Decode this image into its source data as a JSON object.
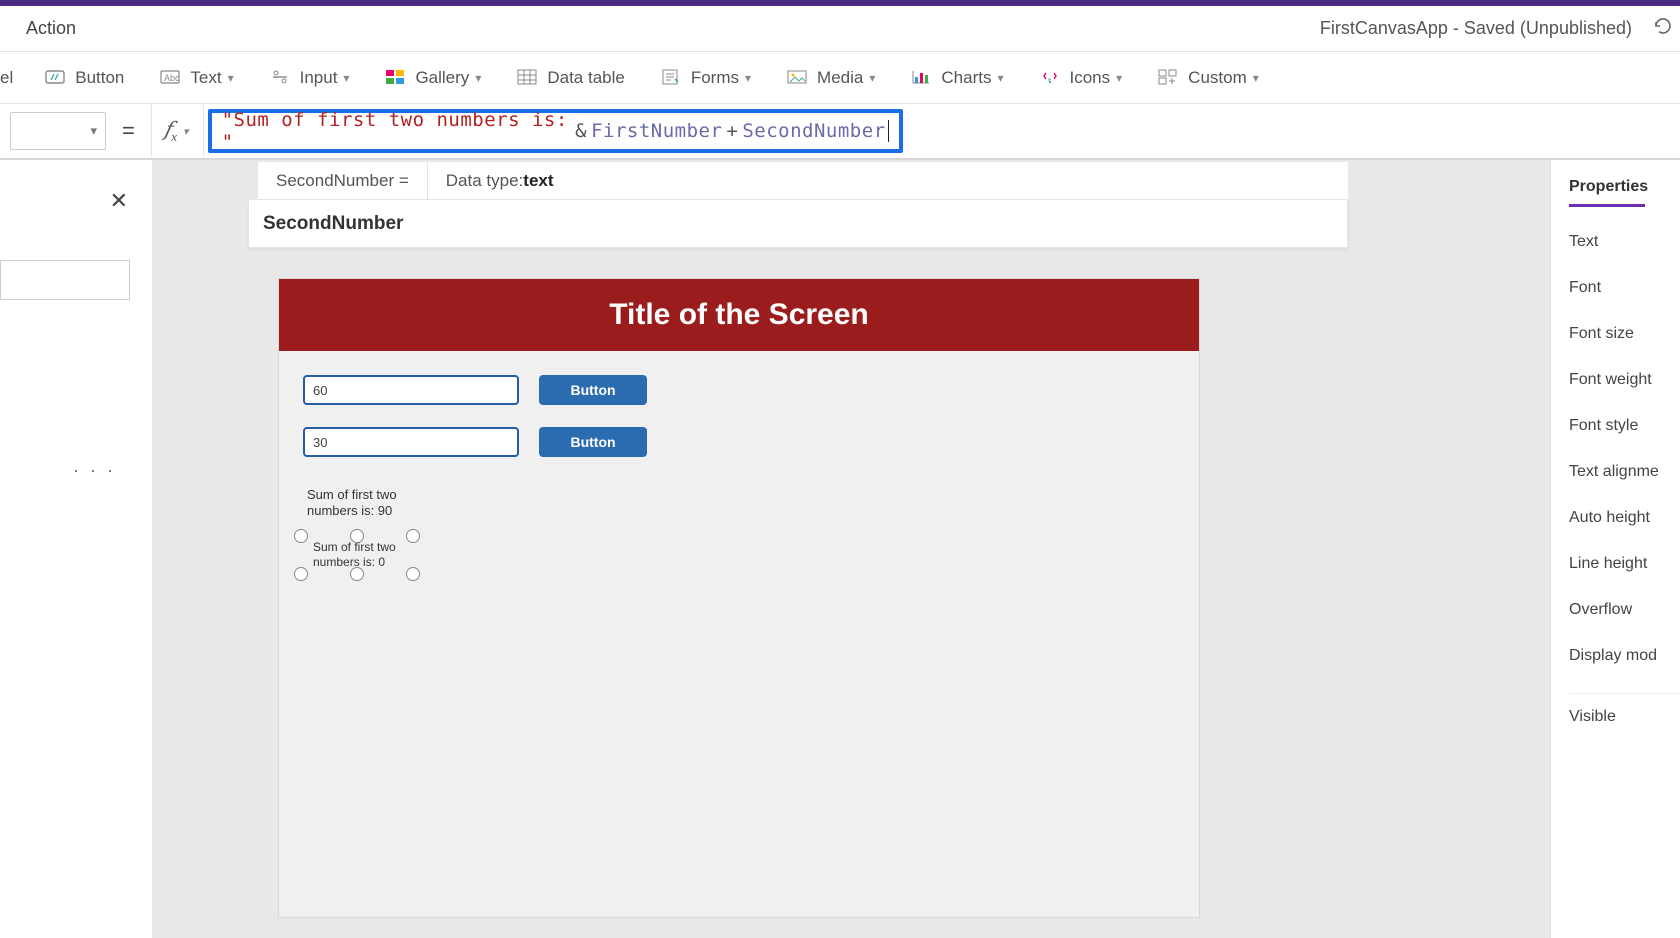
{
  "header": {
    "tab": "Action",
    "app_title": "FirstCanvasApp - Saved (Unpublished)"
  },
  "ribbon": {
    "partial_left": "el",
    "button": "Button",
    "text": "Text",
    "input": "Input",
    "gallery": "Gallery",
    "datatable": "Data table",
    "forms": "Forms",
    "media": "Media",
    "charts": "Charts",
    "icons": "Icons",
    "custom": "Custom"
  },
  "formula": {
    "fx": "fx",
    "str": "\"Sum of first two numbers is: \"",
    "amp": "&",
    "var1": "FirstNumber",
    "plus": "+",
    "var2": "SecondNumber"
  },
  "intellisense": {
    "row1_left": "SecondNumber  =",
    "row1_right_label": "Data type: ",
    "row1_right_value": "text",
    "row2": "SecondNumber"
  },
  "canvas": {
    "title": "Title of the Screen",
    "input1": "60",
    "input2": "30",
    "button_label": "Button",
    "result1": "Sum of first two numbers is: 90",
    "result2": "Sum of first two numbers is: 0"
  },
  "right_panel": {
    "header": "Properties",
    "items": [
      "Text",
      "Font",
      "Font size",
      "Font weight",
      "Font style",
      "Text alignme",
      "Auto height",
      "Line height",
      "Overflow",
      "Display mod",
      "Visible"
    ]
  },
  "left_rail": {
    "dots": "· · ·"
  }
}
